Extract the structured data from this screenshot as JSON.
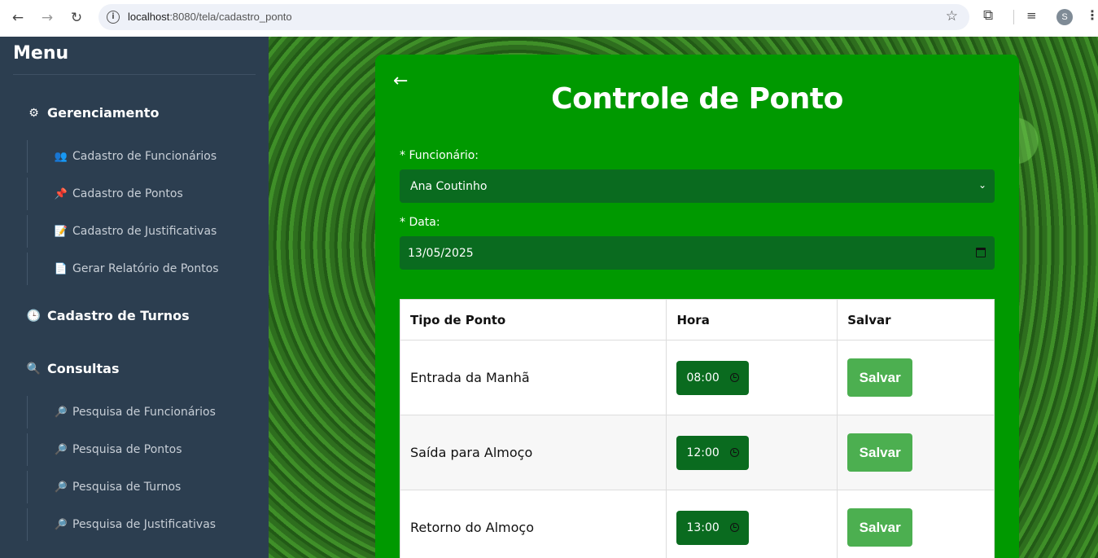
{
  "browser": {
    "url_host": "localhost",
    "url_rest": ":8080/tela/cadastro_ponto",
    "profile_initial": "S"
  },
  "sidebar": {
    "title": "Menu",
    "sections": [
      {
        "label": "Gerenciamento",
        "icon": "⚙",
        "items": [
          {
            "label": "Cadastro de Funcionários",
            "icon": "👥"
          },
          {
            "label": "Cadastro de Pontos",
            "icon": "📌"
          },
          {
            "label": "Cadastro de Justificativas",
            "icon": "📝"
          },
          {
            "label": "Gerar Relatório de Pontos",
            "icon": "📄"
          }
        ]
      },
      {
        "label": "Cadastro de Turnos",
        "icon": "🕒",
        "items": []
      },
      {
        "label": "Consultas",
        "icon": "🔍",
        "items": [
          {
            "label": "Pesquisa de Funcionários",
            "icon": "🔎"
          },
          {
            "label": "Pesquisa de Pontos",
            "icon": "🔎"
          },
          {
            "label": "Pesquisa de Turnos",
            "icon": "🔎"
          },
          {
            "label": "Pesquisa de Justificativas",
            "icon": "🔎"
          }
        ]
      }
    ]
  },
  "form": {
    "back_glyph": "←",
    "title": "Controle de Ponto",
    "employee_label": "* Funcionário:",
    "employee_value": "Ana Coutinho",
    "date_label": "* Data:",
    "date_value": "13/05/2025"
  },
  "table": {
    "headers": [
      "Tipo de Ponto",
      "Hora",
      "Salvar"
    ],
    "rows": [
      {
        "type": "Entrada da Manhã",
        "time": "08:00",
        "action": "Salvar"
      },
      {
        "type": "Saída para Almoço",
        "time": "12:00",
        "action": "Salvar"
      },
      {
        "type": "Retorno do Almoço",
        "time": "13:00",
        "action": "Salvar"
      }
    ]
  },
  "colors": {
    "sidebar_bg": "#2c3e50",
    "card_bg": "#009900",
    "field_bg": "#0a6b1f",
    "save_button": "#4caf50"
  }
}
